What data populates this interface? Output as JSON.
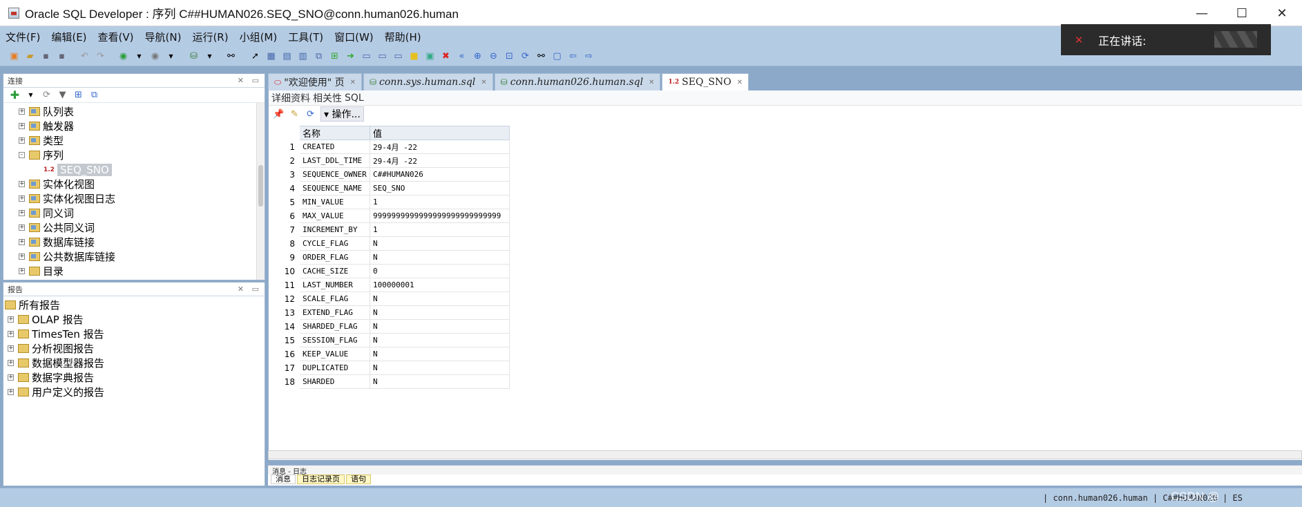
{
  "window": {
    "title": "Oracle SQL Developer : 序列 C##HUMAN026.SEQ_SNO@conn.human026.human"
  },
  "menu": [
    "文件(F)",
    "编辑(E)",
    "查看(V)",
    "导航(N)",
    "运行(R)",
    "小组(M)",
    "工具(T)",
    "窗口(W)",
    "帮助(H)"
  ],
  "notification": {
    "text": "正在讲话:"
  },
  "connections": {
    "title": "连接",
    "items": [
      {
        "label": "队列表",
        "expand": "+"
      },
      {
        "label": "触发器",
        "expand": "+"
      },
      {
        "label": "类型",
        "expand": "+"
      },
      {
        "label": "序列",
        "expand": "-"
      },
      {
        "label": "SEQ_SNO",
        "expand": "",
        "child": true,
        "selected": true
      },
      {
        "label": "实体化视图",
        "expand": "+"
      },
      {
        "label": "实体化视图日志",
        "expand": "+"
      },
      {
        "label": "同义词",
        "expand": "+"
      },
      {
        "label": "公共同义词",
        "expand": "+"
      },
      {
        "label": "数据库链接",
        "expand": "+"
      },
      {
        "label": "公共数据库链接",
        "expand": "+"
      },
      {
        "label": "目录",
        "expand": "+"
      }
    ]
  },
  "reports": {
    "title": "报告",
    "root": "所有报告",
    "items": [
      "OLAP 报告",
      "TimesTen 报告",
      "分析视图报告",
      "数据模型器报告",
      "数据字典报告",
      "用户定义的报告"
    ]
  },
  "tabs": [
    {
      "label": "\"欢迎使用\" 页",
      "icon": "oracle-icon",
      "active": false
    },
    {
      "label": "conn.sys.human.sql",
      "icon": "sql-icon",
      "active": false
    },
    {
      "label": "conn.human026.human.sql",
      "icon": "sql-icon",
      "active": false
    },
    {
      "label": "SEQ_SNO",
      "icon": "sequence-icon",
      "active": true
    }
  ],
  "subtabs": [
    "详细资料",
    "相关性",
    "SQL"
  ],
  "actions_label": "操作...",
  "grid": {
    "columns": [
      "名称",
      "值"
    ],
    "rows": [
      [
        "CREATED",
        "29-4月 -22"
      ],
      [
        "LAST_DDL_TIME",
        "29-4月 -22"
      ],
      [
        "SEQUENCE_OWNER",
        "C##HUMAN026"
      ],
      [
        "SEQUENCE_NAME",
        "SEQ_SNO"
      ],
      [
        "MIN_VALUE",
        "1"
      ],
      [
        "MAX_VALUE",
        "9999999999999999999999999999"
      ],
      [
        "INCREMENT_BY",
        "1"
      ],
      [
        "CYCLE_FLAG",
        "N"
      ],
      [
        "ORDER_FLAG",
        "N"
      ],
      [
        "CACHE_SIZE",
        "0"
      ],
      [
        "LAST_NUMBER",
        "100000001"
      ],
      [
        "SCALE_FLAG",
        "N"
      ],
      [
        "EXTEND_FLAG",
        "N"
      ],
      [
        "SHARDED_FLAG",
        "N"
      ],
      [
        "SESSION_FLAG",
        "N"
      ],
      [
        "KEEP_VALUE",
        "N"
      ],
      [
        "DUPLICATED",
        "N"
      ],
      [
        "SHARDED",
        "N"
      ]
    ]
  },
  "messages": {
    "title": "消息 - 日志",
    "tabs": [
      "消息",
      "日志记录页",
      "语句"
    ]
  },
  "status": {
    "text": "| conn.human026.human | C##HUMAN026 | ES",
    "watermark": "CSDN @"
  }
}
